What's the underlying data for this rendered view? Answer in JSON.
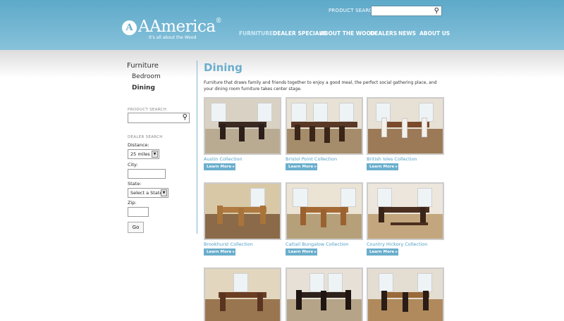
{
  "header": {
    "logo_mark": "A",
    "logo_text": "AAmerica",
    "logo_reg": "®",
    "tagline": "It's all about the Wood",
    "search_label": "PRODUCT SEARCH",
    "search_icon": "search-icon",
    "nav": [
      "FURNITURE",
      "DEALER SPECIALS",
      "ABOUT THE WOOD",
      "DEALERS",
      "NEWS",
      "ABOUT US"
    ],
    "active_nav": "FURNITURE",
    "colors": {
      "header": "#6aaecd",
      "accent": "#4d9ec4"
    }
  },
  "sidebar": {
    "title": "Furniture",
    "items": [
      "Bedroom",
      "Dining"
    ],
    "active_item": "Dining",
    "product_search_label": "PRODUCT SEARCH",
    "dealer_search_label": "DEALER SEARCH",
    "distance_label": "Distance:",
    "distance_value": "25 miles",
    "city_label": "City:",
    "state_label": "State:",
    "state_value": "Select a State",
    "zip_label": "Zip:",
    "go_label": "Go"
  },
  "main": {
    "title": "Dining",
    "intro": "Furniture that draws family and friends together to enjoy a good meal, the perfect social gathering place, and your dining room furniture takes center stage.",
    "learn_more": "Learn More",
    "learn_arrow": "▸",
    "collections": [
      {
        "name": "Austin Collection"
      },
      {
        "name": "Bristol Point Collection"
      },
      {
        "name": "British Isles Collection"
      },
      {
        "name": "Brookhurst Collection"
      },
      {
        "name": "Cattail Bungalow Collection"
      },
      {
        "name": "Country Hickory Collection"
      },
      {
        "name": ""
      },
      {
        "name": ""
      },
      {
        "name": ""
      }
    ]
  }
}
